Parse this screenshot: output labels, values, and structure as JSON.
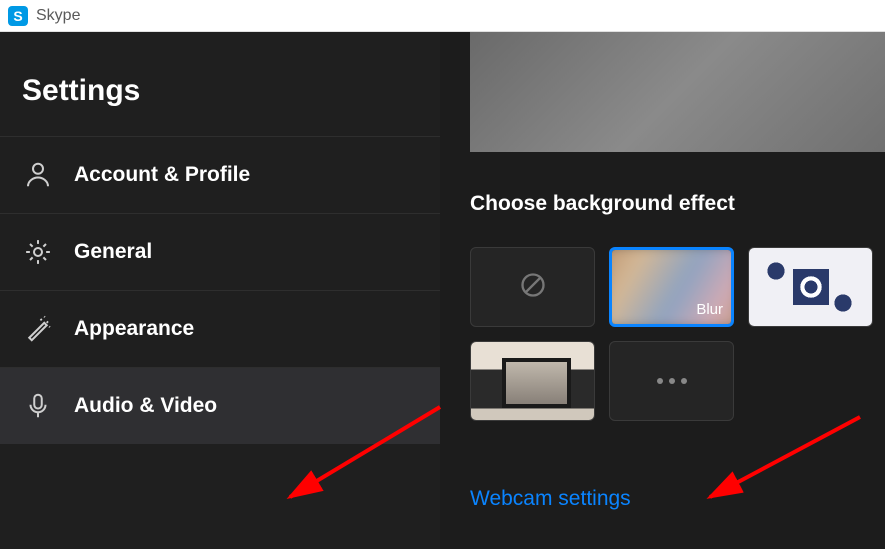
{
  "titlebar": {
    "app_name": "Skype",
    "logo_letter": "S"
  },
  "sidebar": {
    "title": "Settings",
    "items": [
      {
        "label": "Account & Profile",
        "icon": "person"
      },
      {
        "label": "General",
        "icon": "gear"
      },
      {
        "label": "Appearance",
        "icon": "wand"
      },
      {
        "label": "Audio & Video",
        "icon": "mic"
      }
    ]
  },
  "content": {
    "bg_effect_title": "Choose background effect",
    "effects": {
      "none": {
        "icon": "none"
      },
      "blur": {
        "label": "Blur",
        "selected": true
      },
      "pattern": {},
      "room": {},
      "more": {}
    },
    "webcam_link": "Webcam settings"
  }
}
